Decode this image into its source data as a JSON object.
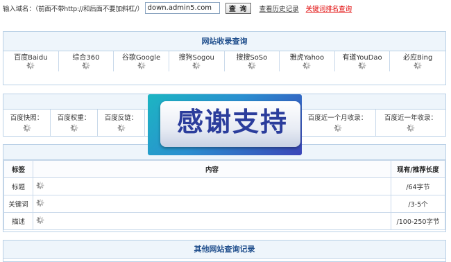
{
  "search": {
    "label": "输入域名：（前面不带http://和后面不要加斜杠/）",
    "value": "down.admin5.com",
    "submit": "查 询",
    "history_link": "查看历史记录",
    "rank_link": "关键词排名查询"
  },
  "indexing": {
    "title": "网站收录查询",
    "engines": [
      "百度Baidu",
      "综合360",
      "谷歌Google",
      "搜狗Sogou",
      "搜搜SoSo",
      "雅虎Yahoo",
      "有道YouDao",
      "必应Bing"
    ]
  },
  "weights": {
    "items": [
      "百度快照：",
      "百度权重：",
      "百度反链：",
      "",
      "百度近一个月收录：",
      "百度近一年收录："
    ]
  },
  "meta": {
    "headers": {
      "tag": "标签",
      "content": "内容",
      "length": "现有/推荐长度"
    },
    "rows": [
      {
        "tag": "标题",
        "length": "/64字节"
      },
      {
        "tag": "关键词",
        "length": "/3-5个"
      },
      {
        "tag": "描述",
        "length": "/100-250字节"
      }
    ]
  },
  "other": {
    "title": "其他网站查询记录"
  },
  "banner": {
    "text": "感谢支持"
  }
}
